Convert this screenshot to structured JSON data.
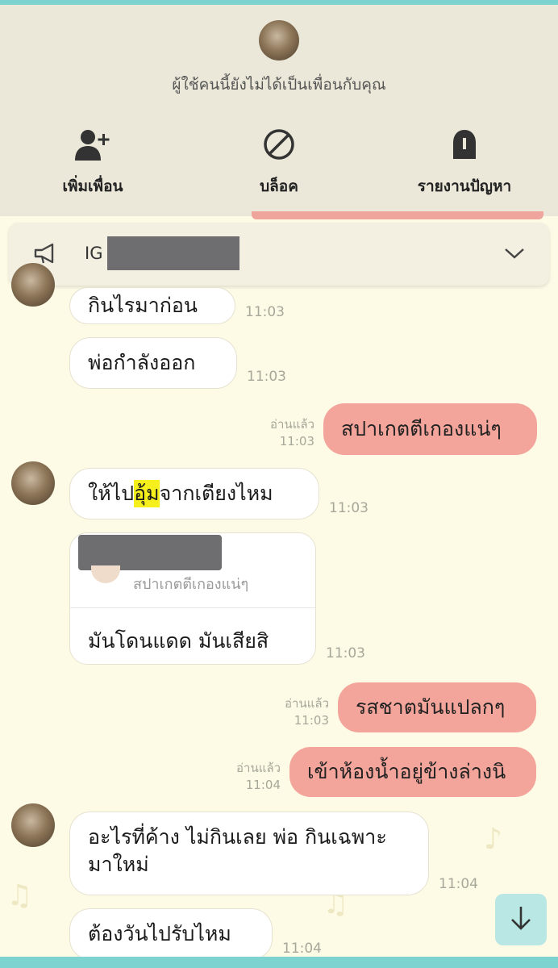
{
  "header": {
    "notice": "ผู้ใช้คนนี้ยังไม่ได้เป็นเพื่อนกับคุณ",
    "actions": [
      {
        "label": "เพิ่มเพื่อน",
        "icon": "add-friend-icon"
      },
      {
        "label": "บล็อค",
        "icon": "block-icon"
      },
      {
        "label": "รายงานปัญหา",
        "icon": "report-icon"
      }
    ]
  },
  "announcement": {
    "prefix": "IG",
    "icon": "megaphone-icon",
    "expand_icon": "chevron-down-icon"
  },
  "messages": [
    {
      "side": "in",
      "text": "กินไรมาก่อน",
      "time": "11:03"
    },
    {
      "side": "in",
      "text": "พ่อกำลังออก",
      "time": "11:03"
    },
    {
      "side": "out",
      "text": "สปาเกตตีเกองแน่ๆ",
      "read": "อ่านแล้ว",
      "time": "11:03"
    },
    {
      "side": "in",
      "text_before": "ให้ไป",
      "text_highlight": "อุ้ม",
      "text_after": "จากเตียงไหม",
      "time": "11:03"
    },
    {
      "side": "in",
      "reply_quote": "สปาเกตตีเกองแน่ๆ",
      "text": "มันโดนแดด  มันเสียสิ",
      "time": "11:03"
    },
    {
      "side": "out",
      "text": "รสชาตมันแปลกๆ",
      "read": "อ่านแล้ว",
      "time": "11:03"
    },
    {
      "side": "out",
      "text": "เข้าห้องน้ำอยู่ข้างล่างนิ",
      "read": "อ่านแล้ว",
      "time": "11:04"
    },
    {
      "side": "in",
      "text": "อะไรที่ค้าง ไม่กินเลย  พ่อ กินเฉพาะมาใหม่",
      "time": "11:04"
    },
    {
      "side": "in",
      "text": "ต้องวันไปรับไหม",
      "time": "11:04"
    }
  ],
  "colors": {
    "outgoing_bubble": "#f4a59b",
    "background": "#fdfbe6",
    "header_panel": "#ebe8d9",
    "accent_teal": "#7dd3cf"
  },
  "scroll_button_icon": "arrow-down-icon"
}
